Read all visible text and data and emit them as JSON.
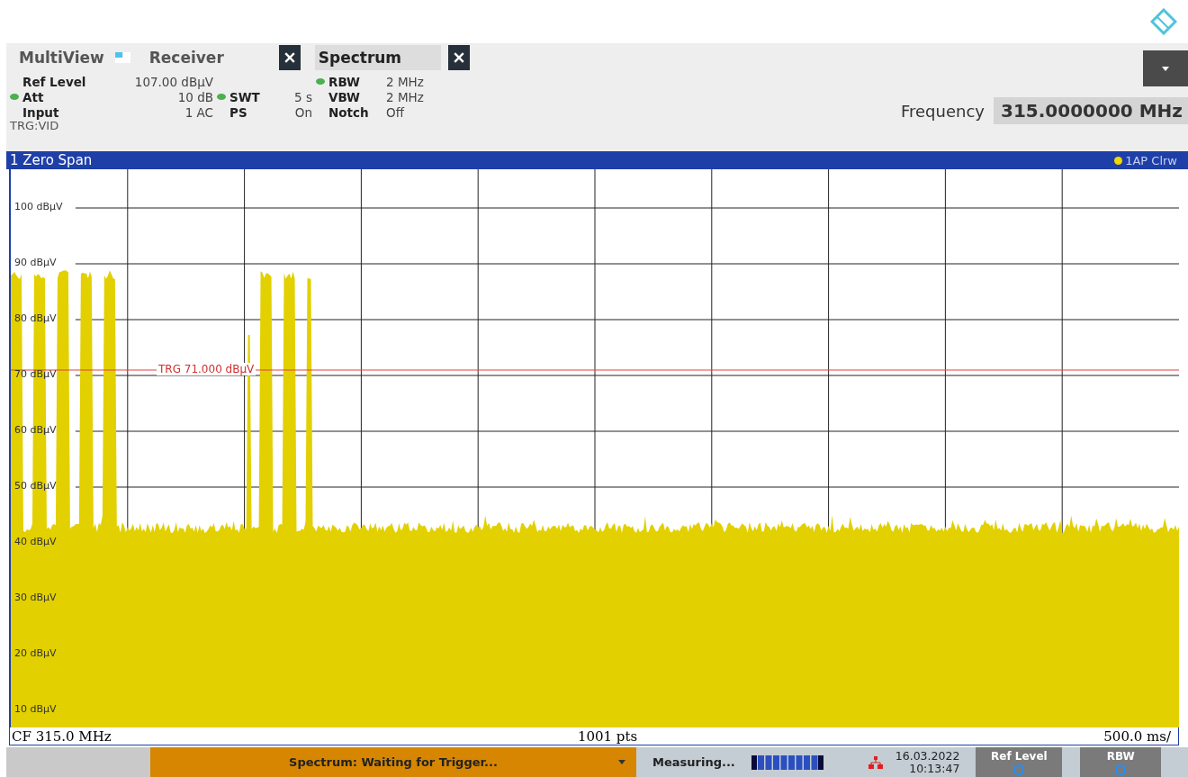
{
  "toolbar": {
    "tabs": [
      {
        "label": "MultiView",
        "kind": "overview",
        "selected": false
      },
      {
        "label": "Receiver",
        "kind": "channel",
        "selected": false
      },
      {
        "label": "Spectrum",
        "kind": "channel",
        "selected": true
      }
    ]
  },
  "settings": [
    [
      {
        "label": "Ref Level",
        "value": "107.00 dBµV",
        "coupled": false
      },
      {
        "label": "Att",
        "value": "10 dB",
        "coupled": true
      },
      {
        "label": "Input",
        "value": "1 AC",
        "coupled": false
      }
    ],
    [
      {
        "label": "SWT",
        "value": "5 s",
        "coupled": true
      },
      {
        "label": "PS",
        "value": "On",
        "coupled": false
      }
    ],
    [
      {
        "label": "RBW",
        "value": "2 MHz",
        "coupled": true
      },
      {
        "label": "VBW",
        "value": "2 MHz",
        "coupled": false
      },
      {
        "label": "Notch",
        "value": "Off",
        "coupled": false
      }
    ]
  ],
  "trigger_source": "TRG:VID",
  "frequency": {
    "label": "Frequency",
    "value": "315.0000000 MHz"
  },
  "diagram": {
    "title": "1 Zero Span",
    "trace_label": "1AP Clrw",
    "y_labels": [
      "100 dBµV",
      "90 dBµV",
      "80 dBµV",
      "70 dBµV",
      "60 dBµV",
      "50 dBµV",
      "40 dBµV",
      "30 dBµV",
      "20 dBµV",
      "10 dBµV"
    ],
    "trigger_line": {
      "label": "TRG  71.000 dBµV"
    },
    "footer": {
      "center_frequency": "CF 315.0 MHz",
      "points": "1001 pts",
      "time_per_division": "500.0 ms/"
    }
  },
  "status_bar": {
    "message": "Spectrum: Waiting for Trigger...",
    "activity": "Measuring...",
    "date": "16.03.2022",
    "time": "10:13:47",
    "softkeys": [
      "Ref Level",
      "RBW"
    ]
  }
}
